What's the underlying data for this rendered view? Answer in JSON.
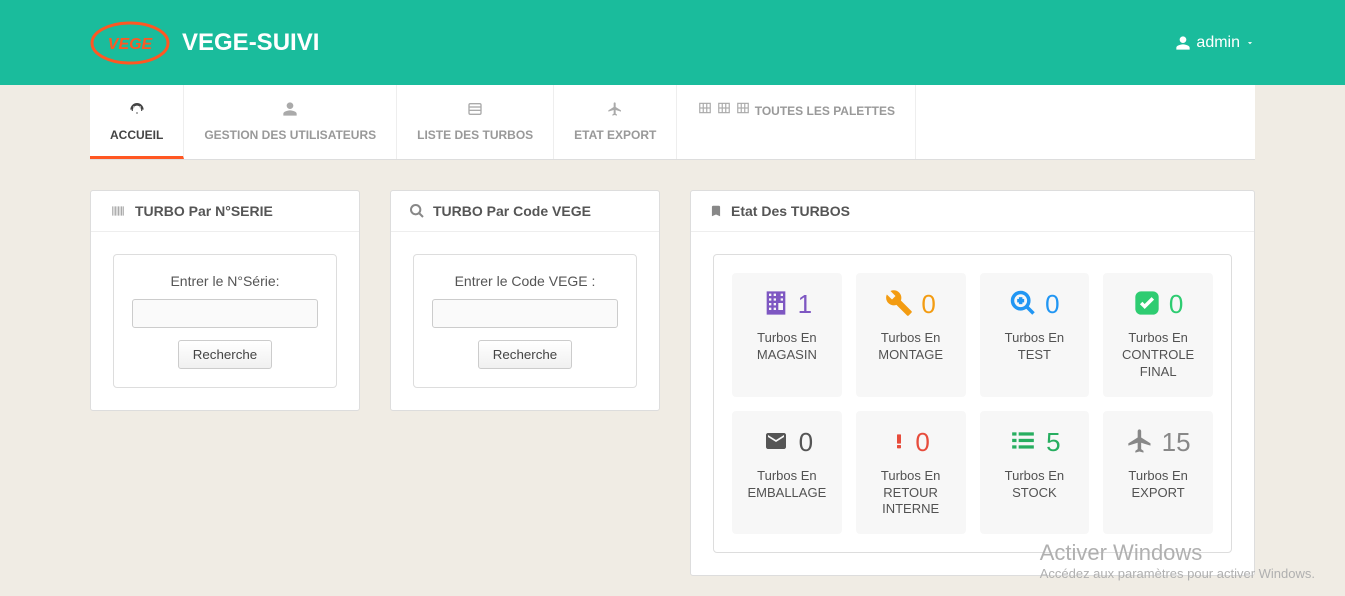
{
  "app": {
    "title": "VEGE-SUIVI",
    "user": "admin"
  },
  "nav": [
    {
      "id": "accueil",
      "label": "ACCUEIL",
      "active": true
    },
    {
      "id": "users",
      "label": "GESTION DES UTILISATEURS"
    },
    {
      "id": "turbos",
      "label": "LISTE DES TURBOS"
    },
    {
      "id": "export",
      "label": "ETAT EXPORT"
    },
    {
      "id": "palettes",
      "label": "TOUTES LES PALETTES"
    }
  ],
  "searchSerial": {
    "title": "TURBO Par N°SERIE",
    "label": "Entrer le N°Série:",
    "value": "",
    "button": "Recherche"
  },
  "searchCode": {
    "title": "TURBO Par Code VEGE",
    "label": "Entrer le Code VEGE :",
    "value": "",
    "button": "Recherche"
  },
  "dashboard": {
    "title": "Etat Des TURBOS",
    "stats": [
      {
        "icon": "building",
        "color": "#7e57c2",
        "value": "1",
        "label": "Turbos En MAGASIN"
      },
      {
        "icon": "wrench",
        "color": "#f39c12",
        "value": "0",
        "label": "Turbos En MONTAGE"
      },
      {
        "icon": "zoom",
        "color": "#2196f3",
        "value": "0",
        "label": "Turbos En TEST"
      },
      {
        "icon": "check",
        "color": "#2ecc71",
        "value": "0",
        "label": "Turbos En CONTROLE FINAL"
      },
      {
        "icon": "envelope",
        "color": "#555",
        "value": "0",
        "label": "Turbos En EMBALLAGE"
      },
      {
        "icon": "exclaim",
        "color": "#e74c3c",
        "value": "0",
        "label": "Turbos En RETOUR INTERNE"
      },
      {
        "icon": "list",
        "color": "#27ae60",
        "value": "5",
        "label": "Turbos En STOCK"
      },
      {
        "icon": "plane",
        "color": "#888",
        "value": "15",
        "label": "Turbos En EXPORT"
      }
    ]
  },
  "watermark": {
    "line1": "Activer Windows",
    "line2": "Accédez aux paramètres pour activer Windows."
  }
}
